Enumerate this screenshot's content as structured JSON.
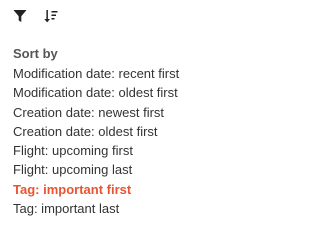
{
  "toolbar": {
    "icons": [
      "filter-icon",
      "sort-icon"
    ]
  },
  "sort_panel": {
    "title": "Sort by",
    "selected_index": 6,
    "options": [
      "Modification date: recent first",
      "Modification date: oldest first",
      "Creation date: newest first",
      "Creation date: oldest first",
      "Flight: upcoming first",
      "Flight: upcoming last",
      "Tag: important first",
      "Tag: important last"
    ]
  },
  "colors": {
    "icon": "#222222",
    "title": "#555555",
    "text": "#333333",
    "selected": "#e8542f"
  }
}
